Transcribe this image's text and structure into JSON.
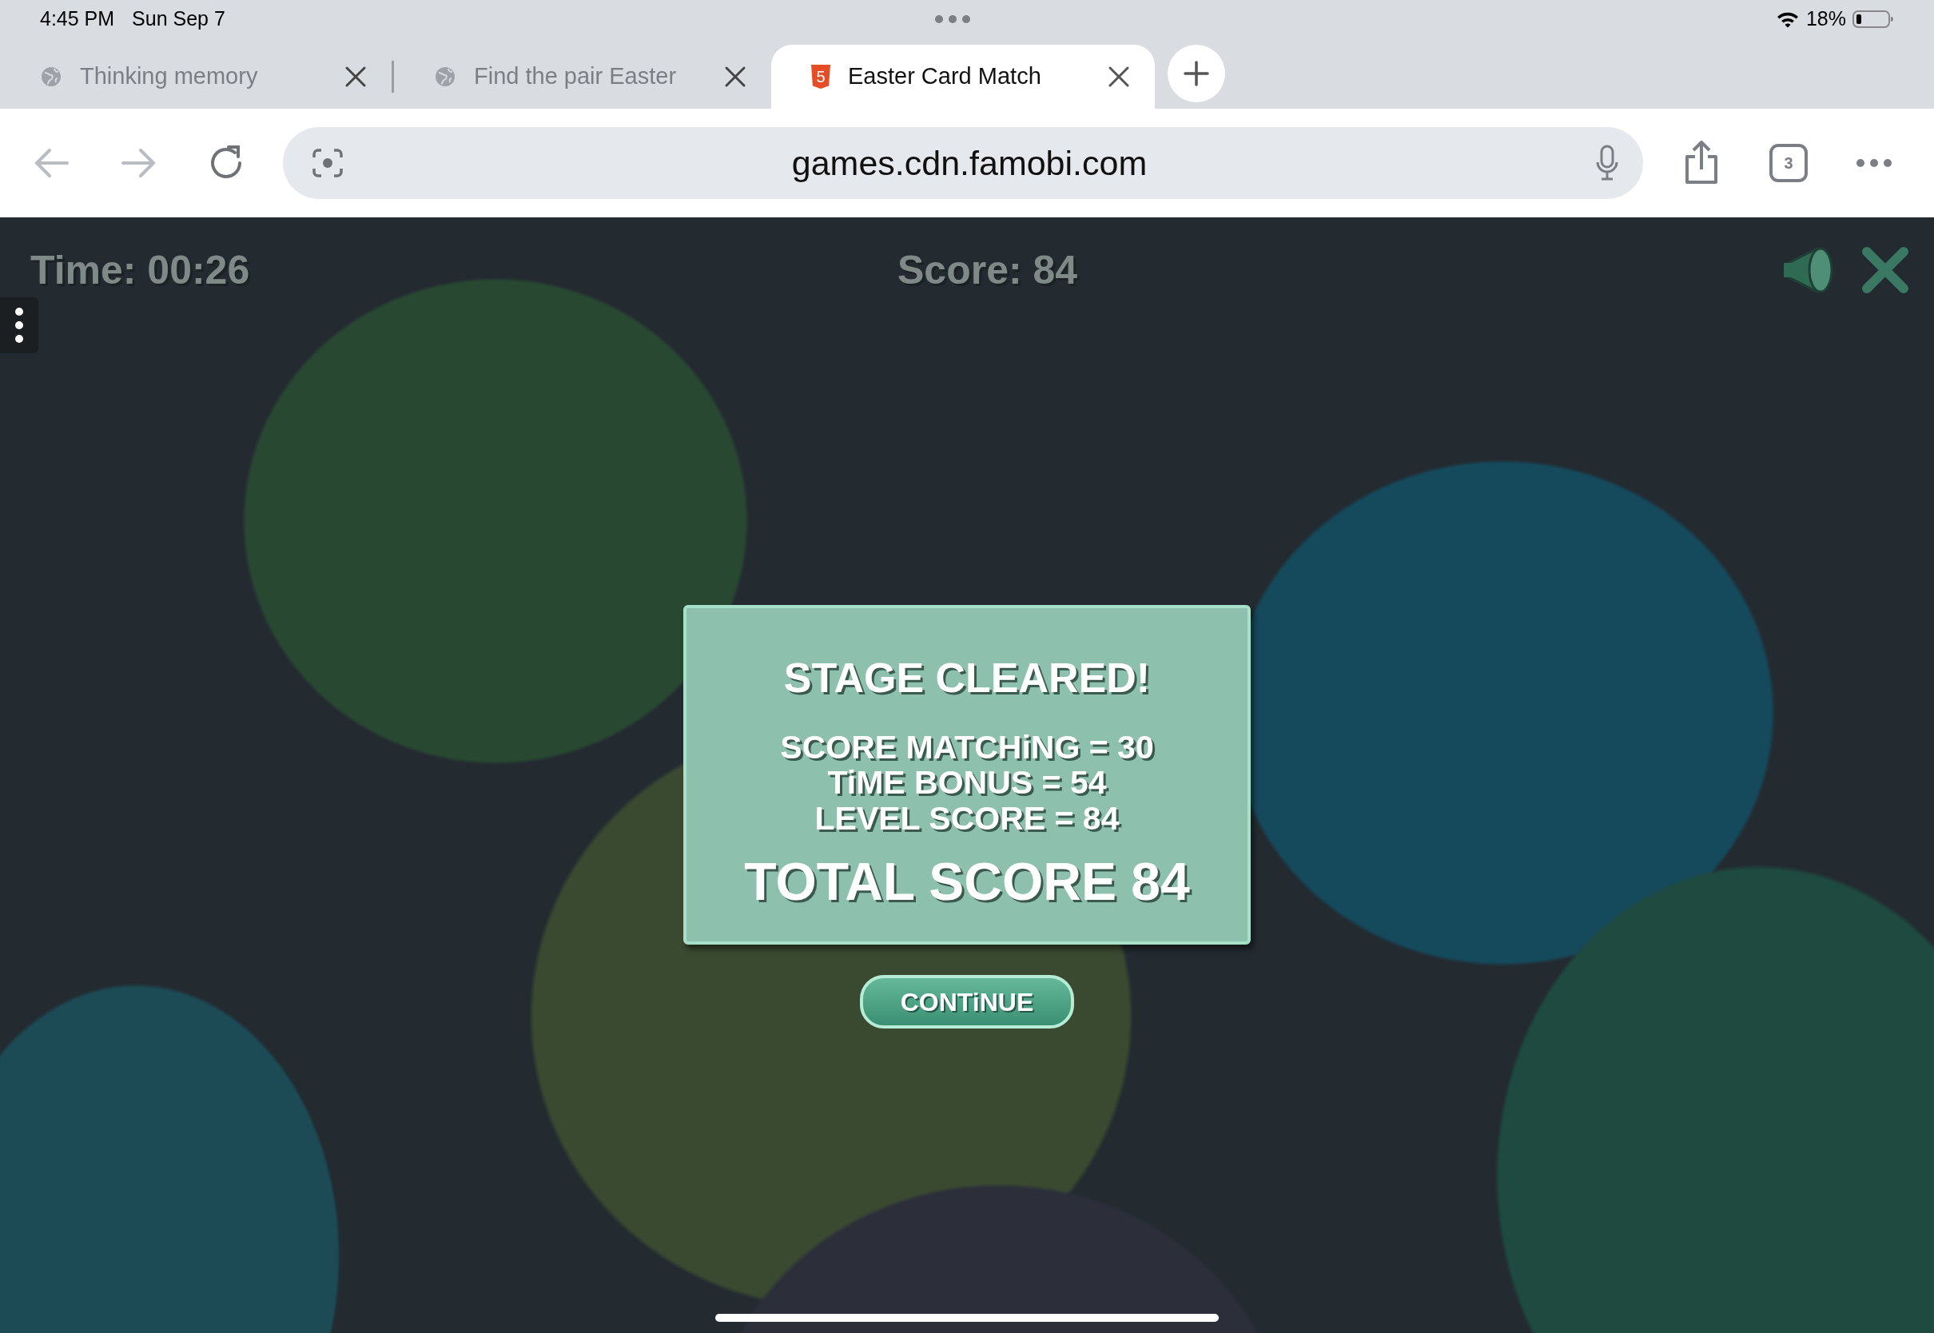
{
  "status_bar": {
    "time": "4:45 PM",
    "date": "Sun Sep 7",
    "battery": "18%"
  },
  "tabs": [
    {
      "title": "Thinking memory",
      "selected": false,
      "kind": "globe"
    },
    {
      "title": "Find the pair Easter",
      "selected": false,
      "kind": "globe"
    },
    {
      "title": "Easter Card Match",
      "selected": true,
      "kind": "html5",
      "favicon_label": "5"
    }
  ],
  "toolbar": {
    "url": "games.cdn.famobi.com",
    "tab_count": "3"
  },
  "game": {
    "time": "Time: 00:26",
    "score": "Score: 84",
    "dialog": {
      "title": "STAGE CLEARED!",
      "lines": [
        "SCORE MATCHiNG = 30",
        "TiME BONUS = 54",
        "LEVEL SCORE = 84"
      ],
      "total": "TOTAL SCORE 84",
      "button": "CONTiNUE"
    }
  }
}
